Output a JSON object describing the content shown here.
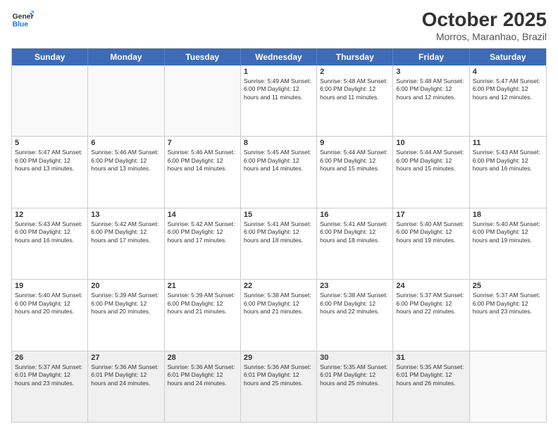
{
  "header": {
    "logo_line1": "General",
    "logo_line2": "Blue",
    "title": "October 2025",
    "subtitle": "Morros, Maranhao, Brazil"
  },
  "day_headers": [
    "Sunday",
    "Monday",
    "Tuesday",
    "Wednesday",
    "Thursday",
    "Friday",
    "Saturday"
  ],
  "weeks": [
    [
      {
        "day": "",
        "info": ""
      },
      {
        "day": "",
        "info": ""
      },
      {
        "day": "",
        "info": ""
      },
      {
        "day": "1",
        "info": "Sunrise: 5:49 AM\nSunset: 6:00 PM\nDaylight: 12 hours\nand 11 minutes."
      },
      {
        "day": "2",
        "info": "Sunrise: 5:48 AM\nSunset: 6:00 PM\nDaylight: 12 hours\nand 11 minutes."
      },
      {
        "day": "3",
        "info": "Sunrise: 5:48 AM\nSunset: 6:00 PM\nDaylight: 12 hours\nand 12 minutes."
      },
      {
        "day": "4",
        "info": "Sunrise: 5:47 AM\nSunset: 6:00 PM\nDaylight: 12 hours\nand 12 minutes."
      }
    ],
    [
      {
        "day": "5",
        "info": "Sunrise: 5:47 AM\nSunset: 6:00 PM\nDaylight: 12 hours\nand 13 minutes."
      },
      {
        "day": "6",
        "info": "Sunrise: 5:46 AM\nSunset: 6:00 PM\nDaylight: 12 hours\nand 13 minutes."
      },
      {
        "day": "7",
        "info": "Sunrise: 5:46 AM\nSunset: 6:00 PM\nDaylight: 12 hours\nand 14 minutes."
      },
      {
        "day": "8",
        "info": "Sunrise: 5:45 AM\nSunset: 6:00 PM\nDaylight: 12 hours\nand 14 minutes."
      },
      {
        "day": "9",
        "info": "Sunrise: 5:44 AM\nSunset: 6:00 PM\nDaylight: 12 hours\nand 15 minutes."
      },
      {
        "day": "10",
        "info": "Sunrise: 5:44 AM\nSunset: 6:00 PM\nDaylight: 12 hours\nand 15 minutes."
      },
      {
        "day": "11",
        "info": "Sunrise: 5:43 AM\nSunset: 6:00 PM\nDaylight: 12 hours\nand 16 minutes."
      }
    ],
    [
      {
        "day": "12",
        "info": "Sunrise: 5:43 AM\nSunset: 6:00 PM\nDaylight: 12 hours\nand 16 minutes."
      },
      {
        "day": "13",
        "info": "Sunrise: 5:42 AM\nSunset: 6:00 PM\nDaylight: 12 hours\nand 17 minutes."
      },
      {
        "day": "14",
        "info": "Sunrise: 5:42 AM\nSunset: 6:00 PM\nDaylight: 12 hours\nand 17 minutes."
      },
      {
        "day": "15",
        "info": "Sunrise: 5:41 AM\nSunset: 6:00 PM\nDaylight: 12 hours\nand 18 minutes."
      },
      {
        "day": "16",
        "info": "Sunrise: 5:41 AM\nSunset: 6:00 PM\nDaylight: 12 hours\nand 18 minutes."
      },
      {
        "day": "17",
        "info": "Sunrise: 5:40 AM\nSunset: 6:00 PM\nDaylight: 12 hours\nand 19 minutes."
      },
      {
        "day": "18",
        "info": "Sunrise: 5:40 AM\nSunset: 6:00 PM\nDaylight: 12 hours\nand 19 minutes."
      }
    ],
    [
      {
        "day": "19",
        "info": "Sunrise: 5:40 AM\nSunset: 6:00 PM\nDaylight: 12 hours\nand 20 minutes."
      },
      {
        "day": "20",
        "info": "Sunrise: 5:39 AM\nSunset: 6:00 PM\nDaylight: 12 hours\nand 20 minutes."
      },
      {
        "day": "21",
        "info": "Sunrise: 5:39 AM\nSunset: 6:00 PM\nDaylight: 12 hours\nand 21 minutes."
      },
      {
        "day": "22",
        "info": "Sunrise: 5:38 AM\nSunset: 6:00 PM\nDaylight: 12 hours\nand 21 minutes."
      },
      {
        "day": "23",
        "info": "Sunrise: 5:38 AM\nSunset: 6:00 PM\nDaylight: 12 hours\nand 22 minutes."
      },
      {
        "day": "24",
        "info": "Sunrise: 5:37 AM\nSunset: 6:00 PM\nDaylight: 12 hours\nand 22 minutes."
      },
      {
        "day": "25",
        "info": "Sunrise: 5:37 AM\nSunset: 6:00 PM\nDaylight: 12 hours\nand 23 minutes."
      }
    ],
    [
      {
        "day": "26",
        "info": "Sunrise: 5:37 AM\nSunset: 6:01 PM\nDaylight: 12 hours\nand 23 minutes."
      },
      {
        "day": "27",
        "info": "Sunrise: 5:36 AM\nSunset: 6:01 PM\nDaylight: 12 hours\nand 24 minutes."
      },
      {
        "day": "28",
        "info": "Sunrise: 5:36 AM\nSunset: 6:01 PM\nDaylight: 12 hours\nand 24 minutes."
      },
      {
        "day": "29",
        "info": "Sunrise: 5:36 AM\nSunset: 6:01 PM\nDaylight: 12 hours\nand 25 minutes."
      },
      {
        "day": "30",
        "info": "Sunrise: 5:35 AM\nSunset: 6:01 PM\nDaylight: 12 hours\nand 25 minutes."
      },
      {
        "day": "31",
        "info": "Sunrise: 5:35 AM\nSunset: 6:01 PM\nDaylight: 12 hours\nand 26 minutes."
      },
      {
        "day": "",
        "info": ""
      }
    ]
  ]
}
